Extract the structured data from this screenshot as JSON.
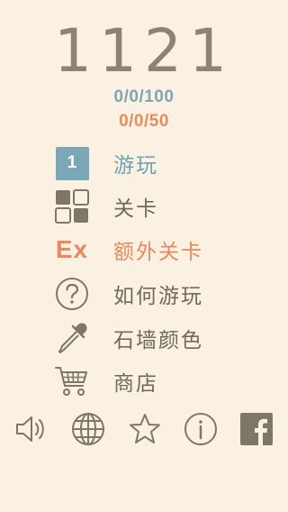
{
  "header": {
    "title": "1121",
    "progress_blue": "0/0/100",
    "progress_orange": "0/0/50"
  },
  "menu": {
    "items": [
      {
        "label": "游玩",
        "icon": "level-badge-icon",
        "badge": "1",
        "color": "blue"
      },
      {
        "label": "关卡",
        "icon": "grid-icon",
        "color": "default"
      },
      {
        "label": "额外关卡",
        "icon": "ex-icon",
        "badge": "Ex",
        "color": "orange"
      },
      {
        "label": "如何游玩",
        "icon": "question-icon",
        "color": "default"
      },
      {
        "label": "石墙颜色",
        "icon": "eyedropper-icon",
        "color": "default"
      },
      {
        "label": "商店",
        "icon": "cart-icon",
        "color": "default"
      }
    ]
  },
  "bottom_bar": {
    "icons": [
      "sound-icon",
      "globe-icon",
      "star-icon",
      "info-icon",
      "facebook-icon"
    ]
  },
  "colors": {
    "background": "#fbf1e2",
    "text": "#7d7769",
    "blue": "#7fa6b3",
    "orange": "#e68c5f"
  }
}
